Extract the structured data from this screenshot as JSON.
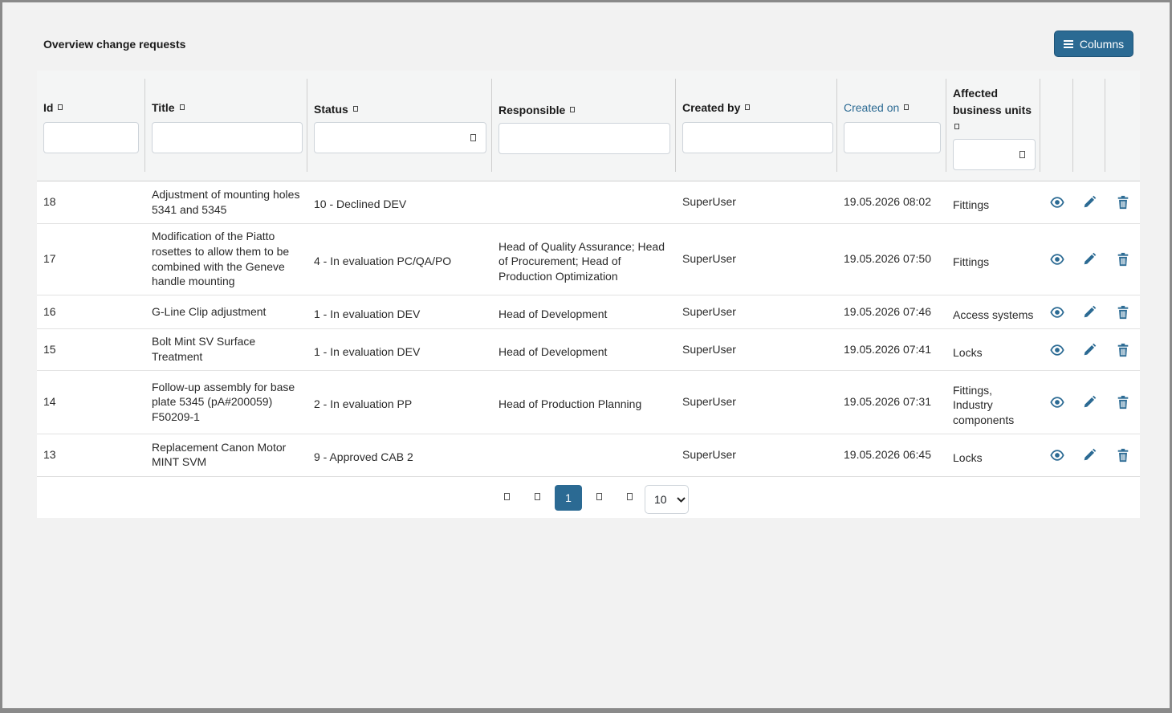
{
  "page": {
    "title": "Overview change requests",
    "columns_button": "Columns"
  },
  "columns": [
    {
      "key": "id",
      "label": "Id"
    },
    {
      "key": "title",
      "label": "Title"
    },
    {
      "key": "status",
      "label": "Status"
    },
    {
      "key": "responsible",
      "label": "Responsible"
    },
    {
      "key": "created_by",
      "label": "Created by"
    },
    {
      "key": "created_on",
      "label": "Created on"
    },
    {
      "key": "affected",
      "label": "Affected business units"
    }
  ],
  "rows": [
    {
      "id": "18",
      "title": "Adjustment of mounting holes 5341 and 5345",
      "status": "10 - Declined DEV",
      "responsible": "",
      "created_by": "SuperUser",
      "created_on": "19.05.2026 08:02",
      "affected": "Fittings"
    },
    {
      "id": "17",
      "title": "Modification of the Piatto rosettes to allow them to be combined with the Geneve handle mounting",
      "status": "4 - In evaluation PC/QA/PO",
      "responsible": "Head of Quality Assurance; Head of Procurement; Head of Production Optimization",
      "created_by": "SuperUser",
      "created_on": "19.05.2026 07:50",
      "affected": "Fittings"
    },
    {
      "id": "16",
      "title": "G-Line Clip adjustment",
      "status": "1 - In evaluation DEV",
      "responsible": "Head of Development",
      "created_by": "SuperUser",
      "created_on": "19.05.2026 07:46",
      "affected": "Access systems"
    },
    {
      "id": "15",
      "title": "Bolt Mint SV Surface Treatment",
      "status": "1 - In evaluation DEV",
      "responsible": "Head of Development",
      "created_by": "SuperUser",
      "created_on": "19.05.2026 07:41",
      "affected": "Locks"
    },
    {
      "id": "14",
      "title": "Follow-up assembly for base plate 5345 (pA#200059) F50209-1",
      "status": "2 - In evaluation PP",
      "responsible": "Head of Production Planning",
      "created_by": "SuperUser",
      "created_on": "19.05.2026 07:31",
      "affected": "Fittings, Industry components"
    },
    {
      "id": "13",
      "title": "Replacement Canon Motor MINT SVM",
      "status": "9 - Approved CAB 2",
      "responsible": "",
      "created_by": "SuperUser",
      "created_on": "19.05.2026 06:45",
      "affected": "Locks"
    }
  ],
  "pagination": {
    "current_page": "1",
    "page_size": "10"
  },
  "colors": {
    "accent": "#2b6a93",
    "header_bg": "#f4f5f5"
  }
}
